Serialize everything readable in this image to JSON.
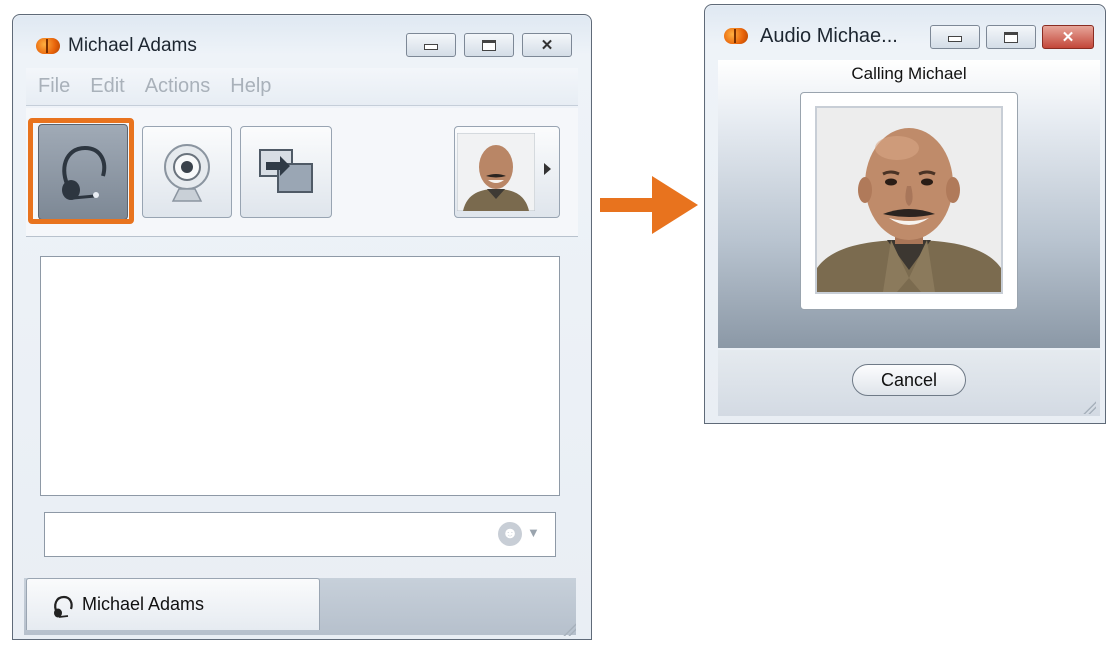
{
  "chat_window": {
    "title": "Michael Adams",
    "menu": [
      "File",
      "Edit",
      "Actions",
      "Help"
    ],
    "toolbar": {
      "audio_icon": "headset-icon",
      "video_icon": "webcam-icon",
      "share_icon": "screen-share-icon"
    },
    "input_value": "",
    "tab_label": "Michael Adams"
  },
  "audio_window": {
    "title": "Audio Michae...",
    "status": "Calling Michael",
    "cancel_label": "Cancel"
  },
  "colors": {
    "accent": "#e8731e",
    "title_orb": "#e8630a",
    "close_button": "#c3473a"
  }
}
